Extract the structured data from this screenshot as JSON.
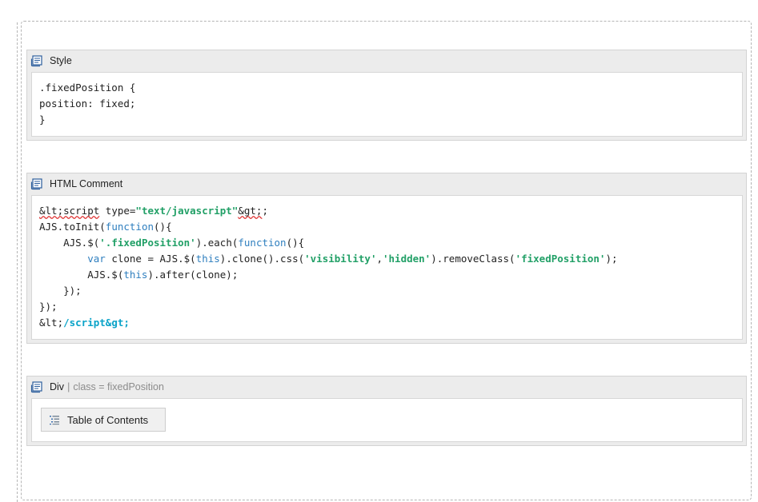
{
  "macros": {
    "style": {
      "title": "Style",
      "icon": "macro-scroll-icon",
      "code": [
        ".fixedPosition {",
        "position: fixed;",
        "}"
      ]
    },
    "html_comment": {
      "title": "HTML Comment",
      "icon": "macro-scroll-icon",
      "code": {
        "line1_lt": "&lt;script",
        "line1_mid": " type=",
        "line1_str": "\"text/javascript\"",
        "line1_gt": "&gt;",
        "line1_end": ";",
        "line2_a": "AJS.toInit(",
        "line2_kw": "function",
        "line2_b": "(){",
        "line3_a": "    AJS.$(",
        "line3_str": "'.fixedPosition'",
        "line3_b": ").each(",
        "line3_kw": "function",
        "line3_c": "(){",
        "line4_kw": "        var",
        "line4_a": " clone = AJS.$(",
        "line4_this": "this",
        "line4_b": ").clone().css(",
        "line4_str1": "'visibility'",
        "line4_comma": ",",
        "line4_str2": "'hidden'",
        "line4_c": ").removeClass(",
        "line4_str3": "'fixedPosition'",
        "line4_d": ");",
        "line5_a": "        AJS.$(",
        "line5_this": "this",
        "line5_b": ").after(clone);",
        "line6": "    });",
        "line7": "});",
        "line8_a": "&lt;",
        "line8_tag": "/script&gt;"
      }
    },
    "div": {
      "title": "Div",
      "separator": "|",
      "param": "class = fixedPosition",
      "icon": "macro-scroll-icon",
      "toc_button": {
        "label": "Table of Contents",
        "icon": "toc-list-icon"
      }
    }
  }
}
